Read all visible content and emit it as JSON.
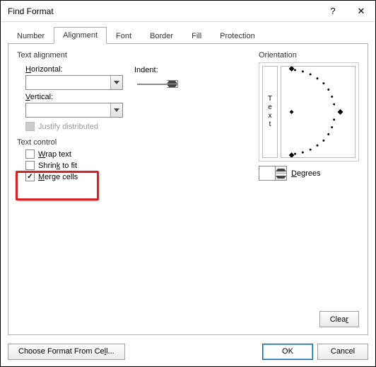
{
  "window": {
    "title": "Find Format",
    "help": "?",
    "close": "✕"
  },
  "tabs": {
    "number": "Number",
    "alignment": "Alignment",
    "font": "Font",
    "border": "Border",
    "fill": "Fill",
    "protection": "Protection"
  },
  "alignment": {
    "section": "Text alignment",
    "horizontal": "Horizontal:",
    "vertical": "Vertical:",
    "indent": "Indent:",
    "justify": "Justify distributed"
  },
  "textcontrol": {
    "section": "Text control",
    "wrap": "Wrap text",
    "shrink": "Shrink to fit",
    "merge": "Merge cells"
  },
  "orientation": {
    "section": "Orientation",
    "text": "Text",
    "degrees": "Degrees"
  },
  "buttons": {
    "clear": "Clear",
    "choose": "Choose Format From Cell...",
    "ok": "OK",
    "cancel": "Cancel"
  }
}
